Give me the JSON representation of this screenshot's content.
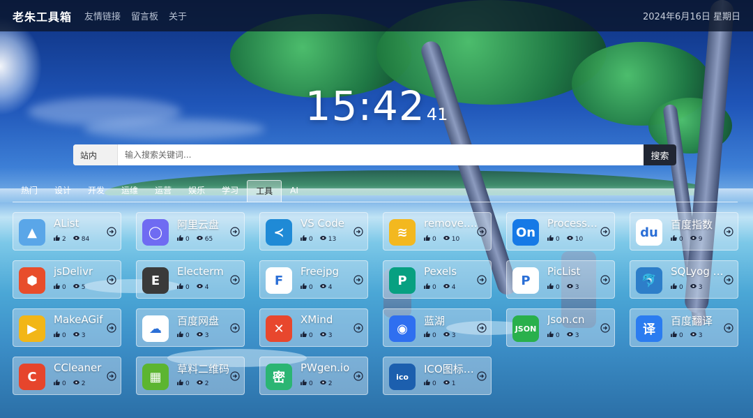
{
  "header": {
    "brand": "老朱工具箱",
    "nav": [
      "友情链接",
      "留言板",
      "关于"
    ],
    "datetime": "2024年6月16日 星期日"
  },
  "clock": {
    "hm": "15:42",
    "seconds": "41"
  },
  "search": {
    "scope": "站内",
    "placeholder": "输入搜索关键词...",
    "button": "搜索"
  },
  "tabs": [
    "热门",
    "设计",
    "开发",
    "运维",
    "运营",
    "娱乐",
    "学习",
    "工具",
    "AI"
  ],
  "active_tab": "工具",
  "cards": [
    {
      "name": "AList",
      "likes": "2",
      "views": "84",
      "icon": "alist-icon",
      "color": "#5aa6e8",
      "glyph": "▲"
    },
    {
      "name": "阿里云盘",
      "likes": "0",
      "views": "65",
      "icon": "aliyun-drive-icon",
      "color": "#6f6bf2",
      "glyph": "◯"
    },
    {
      "name": "VS Code",
      "likes": "0",
      "views": "13",
      "icon": "vscode-icon",
      "color": "#1f8ad6",
      "glyph": "≺"
    },
    {
      "name": "remove.bg",
      "likes": "0",
      "views": "10",
      "icon": "removebg-icon",
      "color": "#f3b81f",
      "glyph": "≋"
    },
    {
      "name": "ProcessOn",
      "likes": "0",
      "views": "10",
      "icon": "processon-icon",
      "color": "#1679e6",
      "glyph": "On"
    },
    {
      "name": "百度指数",
      "likes": "0",
      "views": "9",
      "icon": "baidu-index-icon",
      "color": "#ffffff",
      "glyph": "du"
    },
    {
      "name": "jsDelivr",
      "likes": "0",
      "views": "5",
      "icon": "jsdelivr-icon",
      "color": "#e84d2b",
      "glyph": "⬢"
    },
    {
      "name": "Electerm",
      "likes": "0",
      "views": "4",
      "icon": "electerm-icon",
      "color": "#3a3a3a",
      "glyph": "E"
    },
    {
      "name": "Freejpg",
      "likes": "0",
      "views": "4",
      "icon": "freejpg-icon",
      "color": "#ffffff",
      "glyph": "F"
    },
    {
      "name": "Pexels",
      "likes": "0",
      "views": "4",
      "icon": "pexels-icon",
      "color": "#07a081",
      "glyph": "P"
    },
    {
      "name": "PicList",
      "likes": "0",
      "views": "3",
      "icon": "piclist-icon",
      "color": "#ffffff",
      "glyph": "P"
    },
    {
      "name": "SQLyog Community",
      "likes": "0",
      "views": "3",
      "icon": "sqlyog-icon",
      "color": "#2d7ec9",
      "glyph": "🐬"
    },
    {
      "name": "MakeAGif",
      "likes": "0",
      "views": "3",
      "icon": "makeagif-icon",
      "color": "#f2b617",
      "glyph": "▶"
    },
    {
      "name": "百度网盘",
      "likes": "0",
      "views": "3",
      "icon": "baidu-netdisk-icon",
      "color": "#ffffff",
      "glyph": "☁"
    },
    {
      "name": "XMind",
      "likes": "0",
      "views": "3",
      "icon": "xmind-icon",
      "color": "#e8472d",
      "glyph": "✕"
    },
    {
      "name": "蓝湖",
      "likes": "0",
      "views": "3",
      "icon": "lanhu-icon",
      "color": "#2f6ff0",
      "glyph": "◉"
    },
    {
      "name": "Json.cn",
      "likes": "0",
      "views": "3",
      "icon": "jsoncn-icon",
      "color": "#29b04c",
      "glyph": "JSON"
    },
    {
      "name": "百度翻译",
      "likes": "0",
      "views": "3",
      "icon": "baidu-translate-icon",
      "color": "#2b7cf0",
      "glyph": "译"
    },
    {
      "name": "CCleaner",
      "likes": "0",
      "views": "2",
      "icon": "ccleaner-icon",
      "color": "#e6452c",
      "glyph": "C"
    },
    {
      "name": "草料二维码",
      "likes": "0",
      "views": "2",
      "icon": "caoliao-qrcode-icon",
      "color": "#5cb531",
      "glyph": "▦"
    },
    {
      "name": "PWgen.io",
      "likes": "0",
      "views": "2",
      "icon": "pwgen-icon",
      "color": "#2bb573",
      "glyph": "密"
    },
    {
      "name": "ICO图标转换",
      "likes": "0",
      "views": "1",
      "icon": "ico-convert-icon",
      "color": "#1c5fae",
      "glyph": "ico"
    }
  ]
}
